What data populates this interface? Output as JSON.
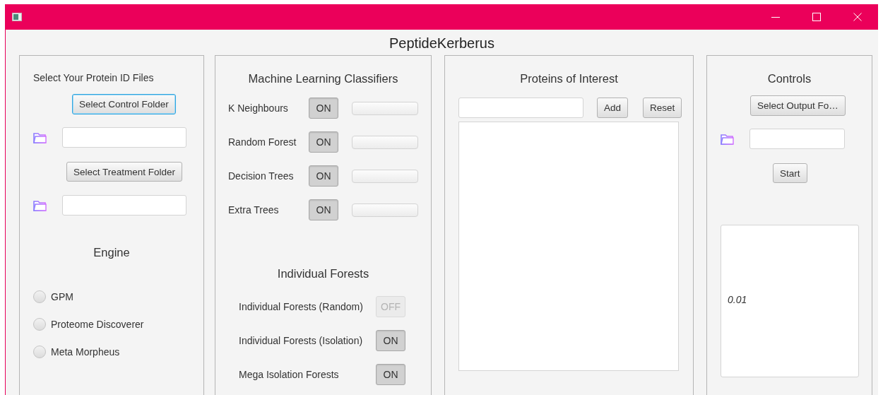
{
  "app_title": "PeptideKerberus",
  "protein_files": {
    "heading": "Select Your Protein ID Files",
    "control_button": {
      "label": "Select Control Folder",
      "focused": true
    },
    "treatment_button": {
      "label": "Select Treatment Folder",
      "focused": false
    }
  },
  "engine": {
    "heading": "Engine",
    "options": [
      {
        "label": "GPM",
        "selected": false
      },
      {
        "label": "Proteome Discoverer",
        "selected": false
      },
      {
        "label": "Meta Morpheus",
        "selected": false
      }
    ]
  },
  "classifiers": {
    "heading": "Machine Learning Classifiers",
    "rows": [
      {
        "label": "K Neighbours",
        "toggle": "ON",
        "on": true,
        "level": 0
      },
      {
        "label": "Random Forest",
        "toggle": "ON",
        "on": true,
        "level": 0
      },
      {
        "label": "Decision Trees",
        "toggle": "ON",
        "on": true,
        "level": 0
      },
      {
        "label": "Extra Trees",
        "toggle": "ON",
        "on": true,
        "level": 0
      }
    ]
  },
  "individual_forests": {
    "heading": "Individual Forests",
    "rows": [
      {
        "label": "Individual Forests (Random)",
        "toggle": "OFF",
        "on": false
      },
      {
        "label": "Individual Forests (Isolation)",
        "toggle": "ON",
        "on": true
      },
      {
        "label": "Mega Isolation Forests",
        "toggle": "ON",
        "on": true
      }
    ]
  },
  "proteins_of_interest": {
    "heading": "Proteins of Interest",
    "add_button": "Add",
    "reset_button": "Reset"
  },
  "controls": {
    "heading": "Controls",
    "output_button": {
      "label": "Select Output Fo…",
      "focused": false
    },
    "start_button": "Start",
    "output_text": "0.01"
  }
}
